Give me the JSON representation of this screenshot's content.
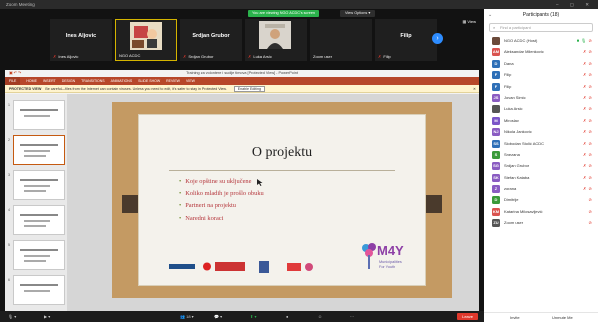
{
  "window": {
    "title": "Zoom Meeting"
  },
  "share": {
    "viewing": "You are viewing NGO ACDC's screen",
    "view_options": "View Options",
    "view": "View"
  },
  "tiles": [
    {
      "name": "Ines Aljovic",
      "label": "Ines Aljovic"
    },
    {
      "name": "",
      "label": "NGO ACDC"
    },
    {
      "name": "Srdjan Grubor",
      "label": "Srdjan Grubor"
    },
    {
      "name": "",
      "label": "Luka Arsic"
    },
    {
      "name": "",
      "label": "Zoom user"
    },
    {
      "name": "Filip",
      "label": "Filip"
    }
  ],
  "ppt": {
    "title": "Training za volontere i sudije timova [Protected View] - PowerPoint",
    "tabs": [
      "FILE",
      "HOME",
      "INSERT",
      "DESIGN",
      "TRANSITIONS",
      "ANIMATIONS",
      "SLIDE SHOW",
      "REVIEW",
      "VIEW"
    ],
    "protected": {
      "label": "PROTECTED VIEW",
      "message": "Be careful—files from the Internet can contain viruses. Unless you need to edit, it's safer to stay in Protected View.",
      "button": "Enable Editing"
    },
    "thumbs": [
      "1",
      "2",
      "3",
      "4",
      "5",
      "6"
    ]
  },
  "slide": {
    "title": "O projektu",
    "bullets": [
      "Koje opštine su uključene",
      "Koliko mladih je prošlo obuku",
      "Partneri na projektu",
      "Naredni koraci"
    ],
    "logo": "M4Y",
    "logo_sub1": "Municipalities",
    "logo_sub2": "For Youth"
  },
  "toolbar": {
    "participants_count": "18",
    "leave": "Leave"
  },
  "panel": {
    "title": "Participants (18)",
    "search_placeholder": "Find a participant",
    "invite": "Invite",
    "unmute": "Unmute Me",
    "participants": [
      {
        "name": "NGO ACDC (Host)",
        "initials": "",
        "color": "#6b4a3a",
        "status": "host"
      },
      {
        "name": "Aleksandar Milenkovic",
        "initials": "AM",
        "color": "#d9534f",
        "status": "muted"
      },
      {
        "name": "Dana",
        "initials": "D",
        "color": "#2e6fb7",
        "status": "muted"
      },
      {
        "name": "Filip",
        "initials": "F",
        "color": "#2e6fb7",
        "status": "muted"
      },
      {
        "name": "Filip",
        "initials": "F",
        "color": "#2e6fb7",
        "status": "muted"
      },
      {
        "name": "Jovan Simic",
        "initials": "JS",
        "color": "#8a5cc2",
        "status": "muted"
      },
      {
        "name": "Luka Arsic",
        "initials": "",
        "color": "#555555",
        "status": "muted"
      },
      {
        "name": "Miroslav",
        "initials": "M",
        "color": "#7a55c8",
        "status": "muted"
      },
      {
        "name": "Nikola Jankovic",
        "initials": "NJ",
        "color": "#8a5cc2",
        "status": "muted"
      },
      {
        "name": "Slobodan Stolić ACDC",
        "initials": "SS",
        "color": "#2e6fb7",
        "status": "muted"
      },
      {
        "name": "Snezana",
        "initials": "S",
        "color": "#3a9a3a",
        "status": "muted"
      },
      {
        "name": "Srdjan Grubor",
        "initials": "SG",
        "color": "#8a5cc2",
        "status": "muted"
      },
      {
        "name": "Stefan Kataba",
        "initials": "SK",
        "color": "#8a5cc2",
        "status": "muted"
      },
      {
        "name": "zorana",
        "initials": "Z",
        "color": "#8a5cc2",
        "status": "muted"
      },
      {
        "name": "Dimitrije",
        "initials": "D",
        "color": "#3a9a3a",
        "status": "nomic"
      },
      {
        "name": "Katarina Milosavljević",
        "initials": "KM",
        "color": "#d9534f",
        "status": "nomic"
      },
      {
        "name": "Zoom user",
        "initials": "ZU",
        "color": "#555555",
        "status": "nomic"
      }
    ]
  }
}
